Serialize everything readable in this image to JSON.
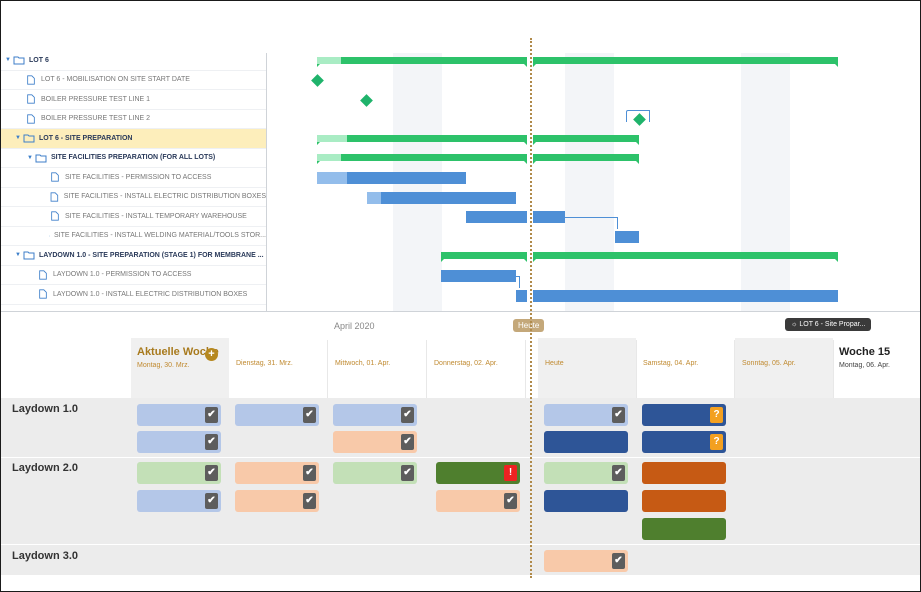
{
  "tree": [
    {
      "label": "LOT 6",
      "type": "group",
      "indent": 0
    },
    {
      "label": "LOT 6 - MOBILISATION ON SITE START DATE",
      "type": "task",
      "indent": 1
    },
    {
      "label": "BOILER PRESSURE TEST LINE 1",
      "type": "task",
      "indent": 1
    },
    {
      "label": "BOILER PRESSURE TEST LINE 2",
      "type": "task",
      "indent": 1
    },
    {
      "label": "LOT 6 - SITE PREPARATION",
      "type": "group",
      "indent": 1,
      "selected": true
    },
    {
      "label": "SITE FACILITIES PREPARATION (FOR ALL LOTS)",
      "type": "group",
      "indent": 2
    },
    {
      "label": "SITE FACILITIES - PERMISSION TO ACCESS",
      "type": "task",
      "indent": 3
    },
    {
      "label": "SITE FACILITIES - INSTALL ELECTRIC DISTRIBUTION BOXES",
      "type": "task",
      "indent": 3
    },
    {
      "label": "SITE FACILITIES - INSTALL TEMPORARY WAREHOUSE",
      "type": "task",
      "indent": 3
    },
    {
      "label": "SITE FACILITIES - INSTALL WELDING MATERIAL/TOOLS STOR...",
      "type": "task",
      "indent": 3
    },
    {
      "label": "LAYDOWN 1.0 - SITE PREPARATION (STAGE 1) FOR MEMBRANE ...",
      "type": "group",
      "indent": 1
    },
    {
      "label": "LAYDOWN 1.0 - PERMISSION TO ACCESS",
      "type": "task",
      "indent": 2
    },
    {
      "label": "LAYDOWN 1.0 - INSTALL ELECTRIC DISTRIBUTION BOXES",
      "type": "task",
      "indent": 2
    }
  ],
  "board": {
    "month": "April 2020",
    "today_chip": "Heute",
    "lot_chip": "LOT 6 - Site Propar...",
    "current_week": {
      "title": "Aktuelle Woche",
      "sub": "Montag, 30. Mrz."
    },
    "days": [
      "Dienstag, 31. Mrz.",
      "Mittwoch, 01. Apr.",
      "Donnerstag, 02. Apr.",
      "Heute",
      "Samstag, 04. Apr.",
      "Sonntag, 05. Apr."
    ],
    "next_week": {
      "title": "Woche 15",
      "sub": "Montag, 06. Apr."
    },
    "lanes": [
      "Laydown 1.0",
      "Laydown 2.0",
      "Laydown 3.0"
    ]
  },
  "colors": {
    "accent": "#b6881f",
    "green_bar": "#2dc26a",
    "blue_bar": "#4e8fd6",
    "selected_row": "#fdeebb"
  }
}
